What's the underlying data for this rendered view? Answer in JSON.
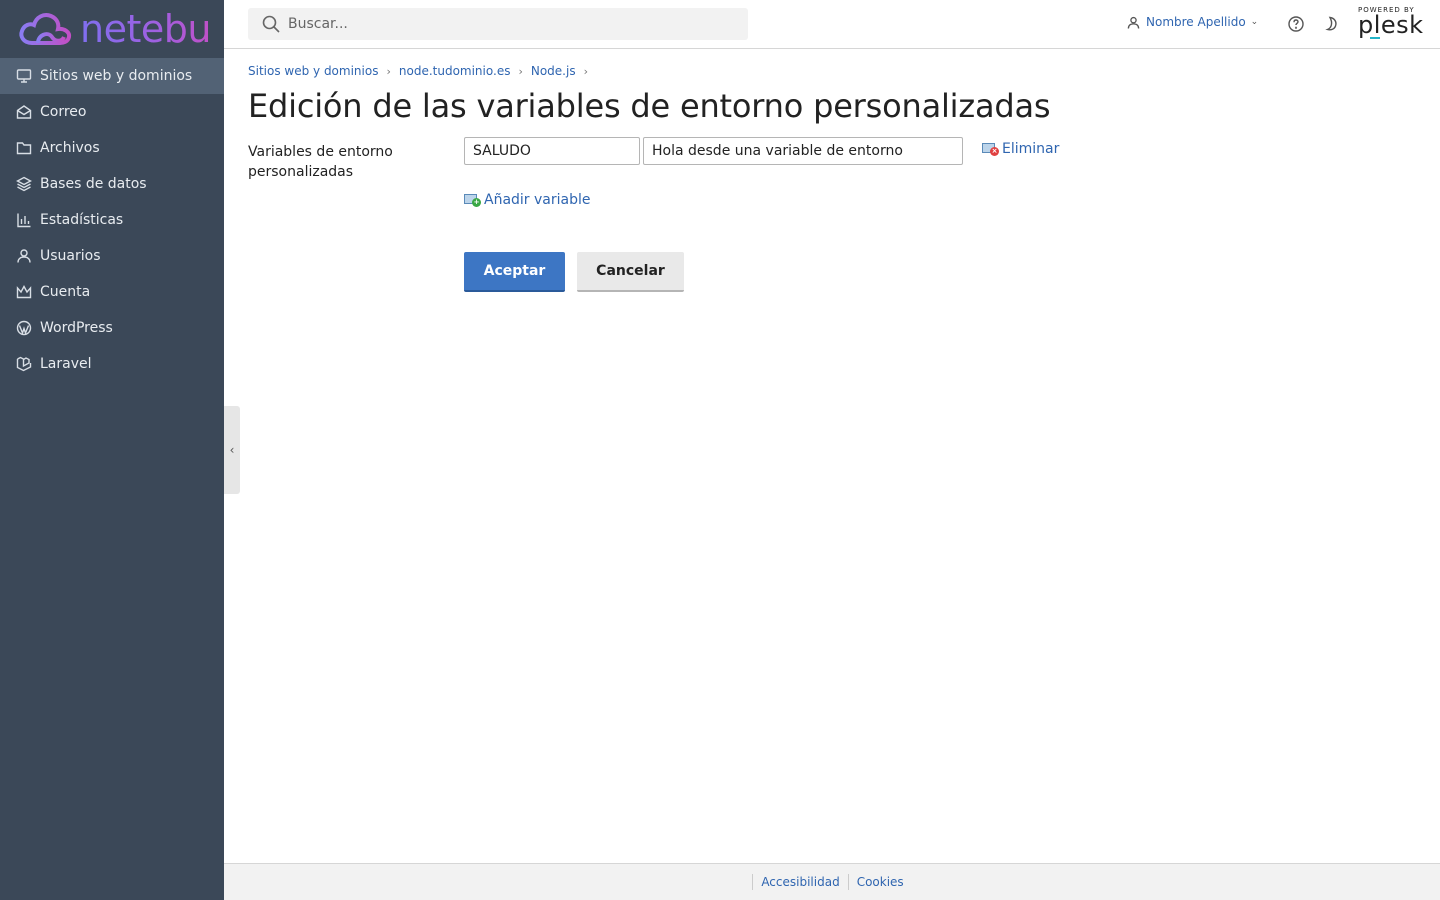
{
  "brand": {
    "name": "netebu",
    "logo_icon": "cloud-logo-icon"
  },
  "sidebar": {
    "items": [
      {
        "label": "Sitios web y dominios",
        "icon": "monitor-icon",
        "active": true
      },
      {
        "label": "Correo",
        "icon": "envelope-icon"
      },
      {
        "label": "Archivos",
        "icon": "folder-icon"
      },
      {
        "label": "Bases de datos",
        "icon": "layers-icon"
      },
      {
        "label": "Estadísticas",
        "icon": "bar-chart-icon"
      },
      {
        "label": "Usuarios",
        "icon": "user-icon"
      },
      {
        "label": "Cuenta",
        "icon": "crown-icon"
      },
      {
        "label": "WordPress",
        "icon": "wordpress-icon"
      },
      {
        "label": "Laravel",
        "icon": "laravel-icon"
      }
    ]
  },
  "header": {
    "search_placeholder": "Buscar...",
    "user_name": "Nombre Apellido",
    "powered_by": "POWERED BY",
    "plesk": "plesk"
  },
  "breadcrumb": [
    "Sitios web y dominios",
    "node.tudominio.es",
    "Node.js"
  ],
  "page": {
    "title": "Edición de las variables de entorno personalizadas",
    "form_label": "Variables de entorno personalizadas",
    "variable": {
      "name": "SALUDO",
      "value": "Hola desde una variable de entorno"
    },
    "remove_label": "Eliminar",
    "add_label": "Añadir variable",
    "ok_label": "Aceptar",
    "cancel_label": "Cancelar"
  },
  "footer": {
    "links": [
      "Accesibilidad",
      "Cookies"
    ]
  },
  "colors": {
    "sidebar_bg": "#3b4858",
    "sidebar_active": "#526275",
    "link": "#2f65b0",
    "primary": "#3d76c4"
  }
}
